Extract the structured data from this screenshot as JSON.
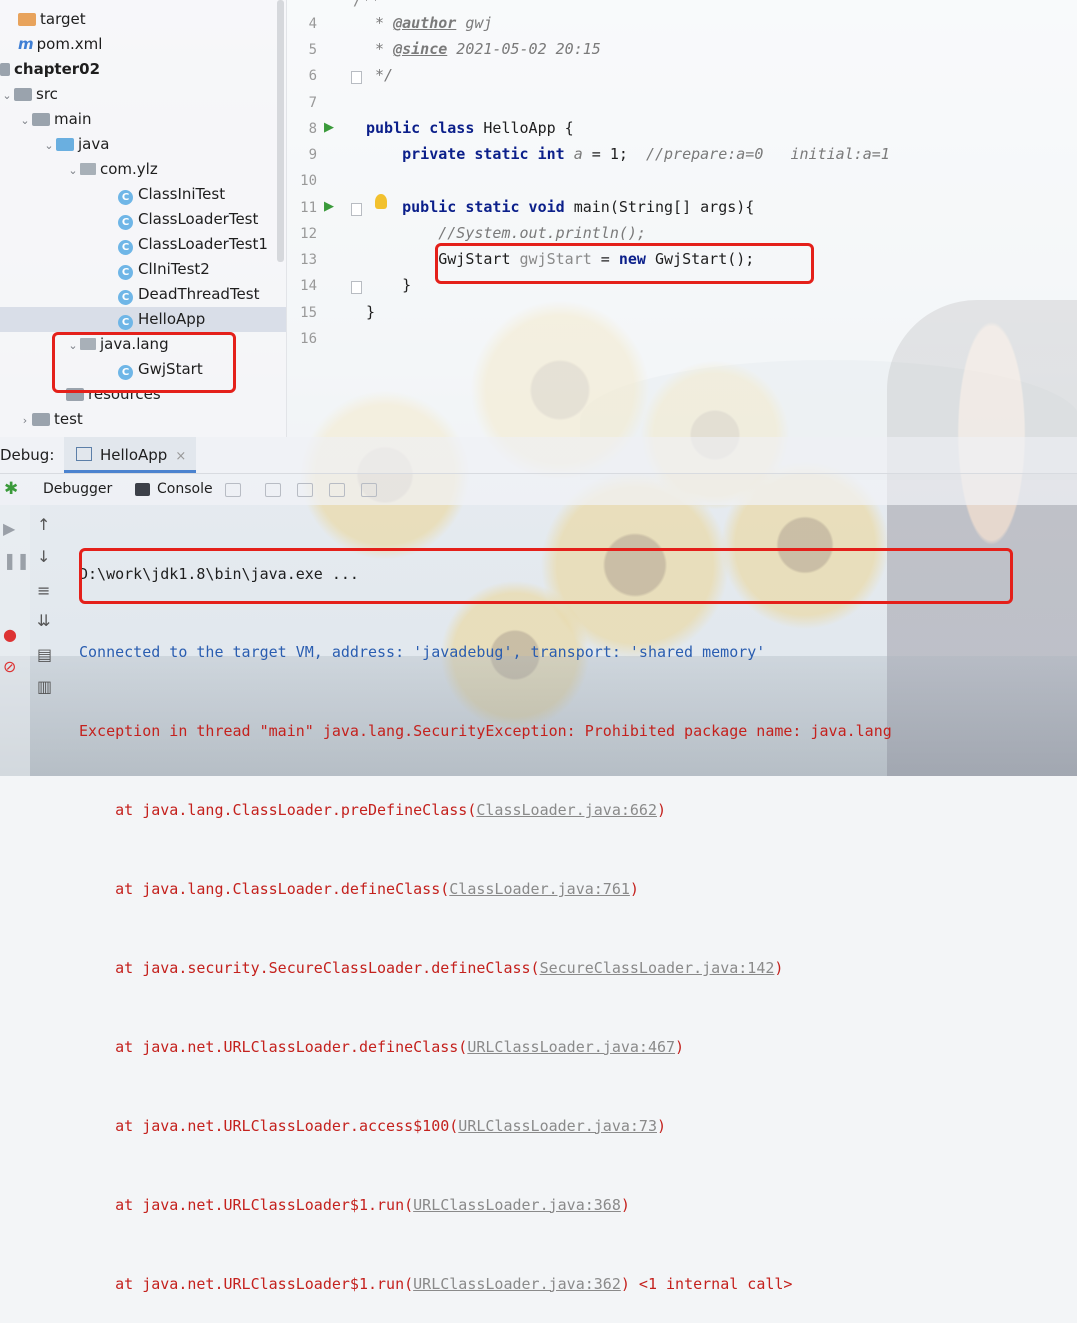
{
  "tree": {
    "items": [
      {
        "label": "target",
        "icon": "folder-icon"
      },
      {
        "label": "pom.xml",
        "icon": "maven-icon"
      },
      {
        "label": "chapter02",
        "icon": "module-icon"
      },
      {
        "label": "src",
        "icon": "folder-icon"
      },
      {
        "label": "main",
        "icon": "folder-icon"
      },
      {
        "label": "java",
        "icon": "source-folder-icon"
      },
      {
        "label": "com.ylz",
        "icon": "package-icon"
      },
      {
        "label": "ClassIniTest",
        "icon": "class-icon"
      },
      {
        "label": "ClassLoaderTest",
        "icon": "class-icon"
      },
      {
        "label": "ClassLoaderTest1",
        "icon": "class-icon"
      },
      {
        "label": "ClIniTest2",
        "icon": "class-icon"
      },
      {
        "label": "DeadThreadTest",
        "icon": "class-icon"
      },
      {
        "label": "HelloApp",
        "icon": "class-icon"
      },
      {
        "label": "java.lang",
        "icon": "package-icon"
      },
      {
        "label": "GwjStart",
        "icon": "class-icon"
      },
      {
        "label": "resources",
        "icon": "folder-icon"
      },
      {
        "label": "test",
        "icon": "folder-icon"
      }
    ],
    "selected": "HelloApp"
  },
  "editor": {
    "line_numbers": [
      "4",
      "5",
      "6",
      "7",
      "8",
      "9",
      "10",
      "11",
      "12",
      "13",
      "14",
      "15",
      "16"
    ],
    "top_partial": "/**",
    "author_tag": "@author",
    "author_value": " gwj",
    "since_tag": "@since",
    "since_value": " 2021-05-02 20:15",
    "comment_end": "*/",
    "class_decl": {
      "kw1": "public class",
      "rest": " HelloApp {"
    },
    "field_decl": {
      "kw": "private static int",
      "var": " a",
      "rest": " = 1;  ",
      "comment": "//prepare:a=0   initial:a=1"
    },
    "main_decl": {
      "kw1": "public static void",
      "rest": " main(String[] args){"
    },
    "commented_line": "//System.out.println();",
    "new_line": {
      "type": "GwjStart ",
      "var": "gwjStart",
      "mid": " = ",
      "kw": "new",
      "rest": " GwjStart();"
    },
    "close_method": "}",
    "close_class": "}"
  },
  "debug": {
    "label": "Debug:",
    "tab": "HelloApp",
    "tabs": [
      "Debugger",
      "Console"
    ]
  },
  "console": {
    "lines": [
      {
        "type": "cmd",
        "text": "D:\\work\\jdk1.8\\bin\\java.exe ..."
      },
      {
        "type": "info",
        "text": "Connected to the target VM, address: 'javadebug', transport: 'shared memory'"
      },
      {
        "type": "err",
        "text": "Exception in thread \"main\" java.lang.SecurityException: Prohibited package name: java.lang"
      }
    ],
    "stack": [
      {
        "prefix": "    at java.lang.ClassLoader.preDefineClass(",
        "link": "ClassLoader.java:662",
        "suffix": ")"
      },
      {
        "prefix": "    at java.lang.ClassLoader.defineClass(",
        "link": "ClassLoader.java:761",
        "suffix": ")"
      },
      {
        "prefix": "    at java.security.SecureClassLoader.defineClass(",
        "link": "SecureClassLoader.java:142",
        "suffix": ")"
      },
      {
        "prefix": "    at java.net.URLClassLoader.defineClass(",
        "link": "URLClassLoader.java:467",
        "suffix": ")"
      },
      {
        "prefix": "    at java.net.URLClassLoader.access$100(",
        "link": "URLClassLoader.java:73",
        "suffix": ")"
      },
      {
        "prefix": "    at java.net.URLClassLoader$1.run(",
        "link": "URLClassLoader.java:368",
        "suffix": ")"
      },
      {
        "prefix": "    at java.net.URLClassLoader$1.run(",
        "link": "URLClassLoader.java:362",
        "suffix": ") <1 internal call>"
      }
    ]
  },
  "colors": {
    "annotation": "#e4201a",
    "keyword": "#0b1f8a",
    "error": "#c4211d",
    "info": "#2a5db0"
  }
}
